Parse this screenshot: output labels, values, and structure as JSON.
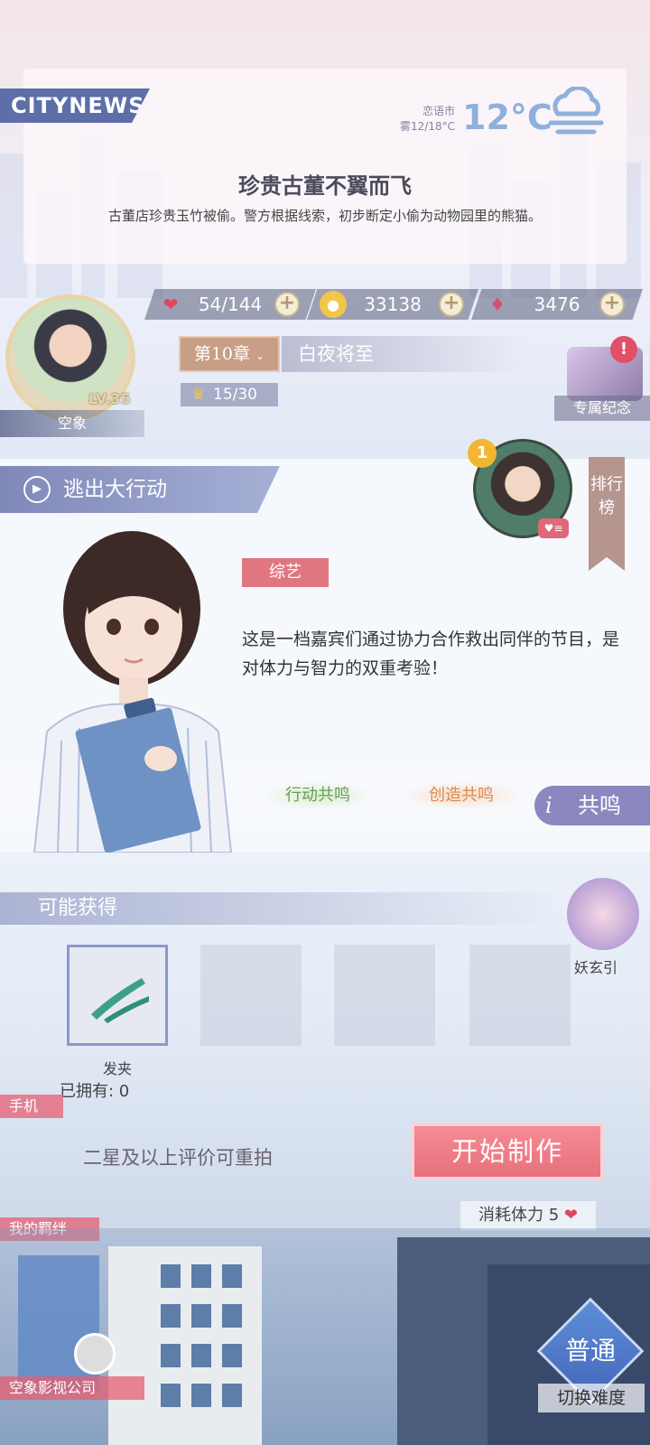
{
  "news": {
    "tag": "CITYNEWS",
    "city": "恋语市",
    "weather": "雾12/18°C",
    "temperature": "12°C",
    "headline": "珍贵古董不翼而飞",
    "body": "古董店珍贵玉竹被偷。警方根据线索，初步断定小偷为动物园里的熊猫。"
  },
  "resources": {
    "stamina": "54/144",
    "coins": "33138",
    "gems": "3476"
  },
  "player": {
    "level": "LV.35",
    "name": "空象"
  },
  "chapter": {
    "label": "第10章",
    "title": "白夜将至",
    "progress": "15/30"
  },
  "souvenir_label": "专属纪念",
  "event": {
    "title": "逃出大行动",
    "genre": "综艺",
    "description": "这是一档嘉宾们通过协力合作救出同伴的节目，是对体力与智力的双重考验！",
    "action_resonance": "行动共鸣",
    "create_resonance": "创造共鸣",
    "resonance_button": "共鸣",
    "rank_label": "排行榜",
    "rank_number": "1"
  },
  "rewards": {
    "header": "可能获得",
    "item_name": "发夹",
    "owned": "已拥有: 0"
  },
  "production": {
    "reshoot_note": "二星及以上评价可重拍",
    "start_button": "开始制作",
    "cost": "消耗体力 5"
  },
  "side": {
    "phone": "手机",
    "bonds": "我的羁绊",
    "yaoxuan": "妖玄引",
    "company": "空象影视公司"
  },
  "difficulty": {
    "current": "普通",
    "switch": "切换难度"
  },
  "colors": {
    "accent_pink": "#e8707c",
    "accent_blue": "#5d6ea8",
    "heart_red": "#e0455c"
  }
}
